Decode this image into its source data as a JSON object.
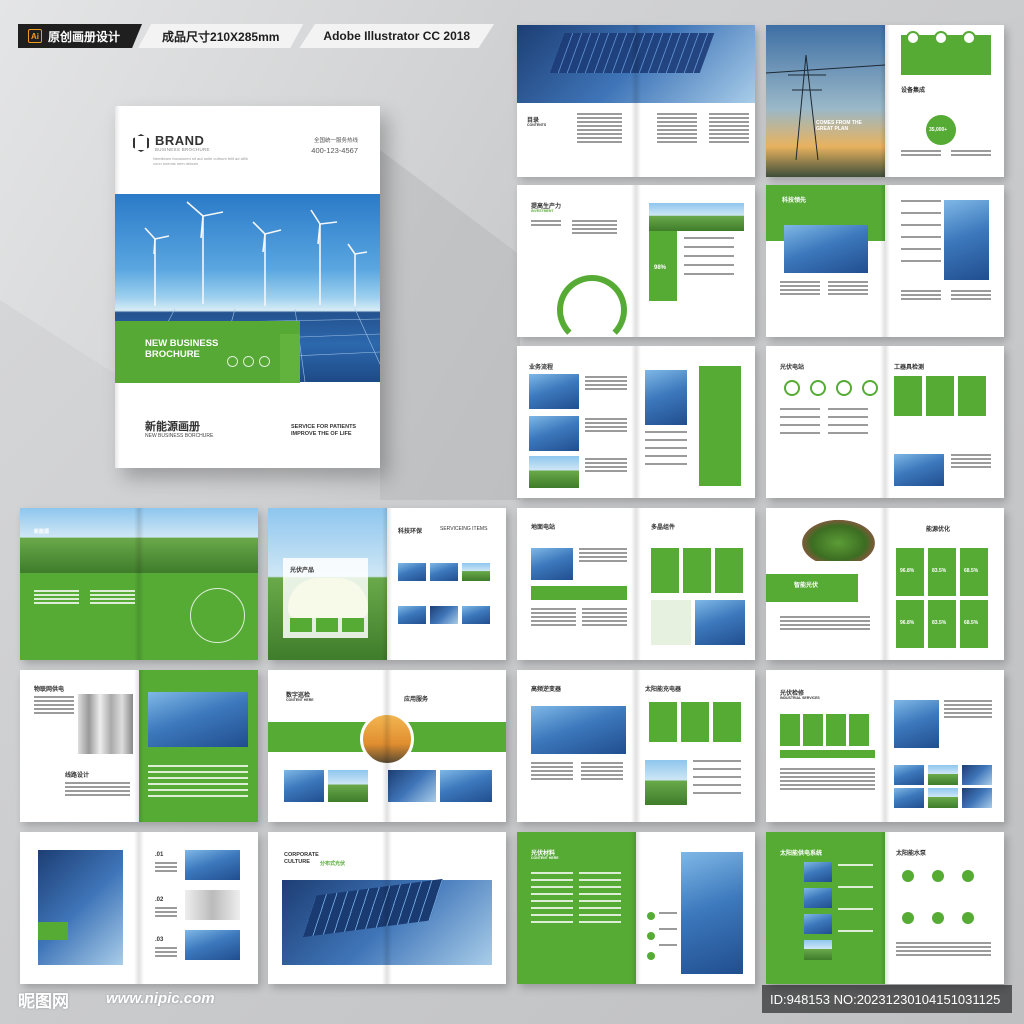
{
  "header": {
    "badge_icon": "Ai",
    "original_label": "原创画册设计",
    "size_label": "成品尺寸210X285mm",
    "software_label": "Adobe Illustrator CC 2018"
  },
  "cover": {
    "brand": "BRAND",
    "brand_sub": "BUSINESS BROCHURE",
    "brand_desc": "Nemilearn focusloren sit aut unite cultrunt felit ad afilh conn loremis nem delusis",
    "hotline_label": "全国统一服务热线",
    "phone": "400-123-4567",
    "green_title": "NEW BUSINESS BROCHURE",
    "cn_title": "新能源画册",
    "en_title": "NEW BUSINESS BORCHURE",
    "service": "SERVICE FOR PATIENTS IMPROVE THE OF LIFE"
  },
  "spreads": {
    "s1": {
      "title": "目录",
      "sub": "CONTENTS"
    },
    "s2": {
      "text": "COMES FROM THE GREAT PLAN",
      "title": "设备集成",
      "stat": "35,000+"
    },
    "s3": {
      "title": "提高生产力",
      "sub": "INVESTMENT",
      "stat": "98%"
    },
    "s4": {
      "title": "科技领先"
    },
    "s5": {
      "title": "业务流程"
    },
    "s6": {
      "title": "光伏电站",
      "title2": "工器具检测"
    },
    "s7": {
      "title": "新能源"
    },
    "s8": {
      "title": "光伏产品",
      "title2": "科技环保",
      "title3": "SERVICEING ITEMS"
    },
    "s9": {
      "title": "地面电站",
      "title2": "多晶组件"
    },
    "s10": {
      "title": "智能光伏",
      "title2": "能源优化",
      "stats": [
        "96.8%",
        "83.5%",
        "68.5%",
        "96.8%",
        "83.5%",
        "68.5%"
      ]
    },
    "s11": {
      "title": "物联网供电",
      "title2": "线路设计"
    },
    "s12": {
      "title": "数字巡检",
      "sub": "CONTENT HERE",
      "title2": "应用服务"
    },
    "s13": {
      "title": "高频逆变器",
      "title2": "太阳能充电器"
    },
    "s14": {
      "title": "光伏检修",
      "sub": "INDUSTRIAL SERVICES"
    },
    "s15": {
      "numbers": [
        ".01",
        ".02",
        ".03"
      ]
    },
    "s16": {
      "title": "CORPORATE CULTURE",
      "title_cn": "分布式光伏"
    },
    "s17": {
      "title": "光伏材料",
      "sub": "CONTENT HERE"
    },
    "s18": {
      "title": "太阳能供电系统",
      "title2": "太阳能水泵"
    }
  },
  "watermark": {
    "site_cn": "昵图网",
    "url": "www.nipic.com",
    "id": "ID:948153 NO:20231230104151031125"
  },
  "colors": {
    "accent": "#56ab35",
    "accent_light": "#7cc353",
    "bg": "#cfd0d1"
  }
}
